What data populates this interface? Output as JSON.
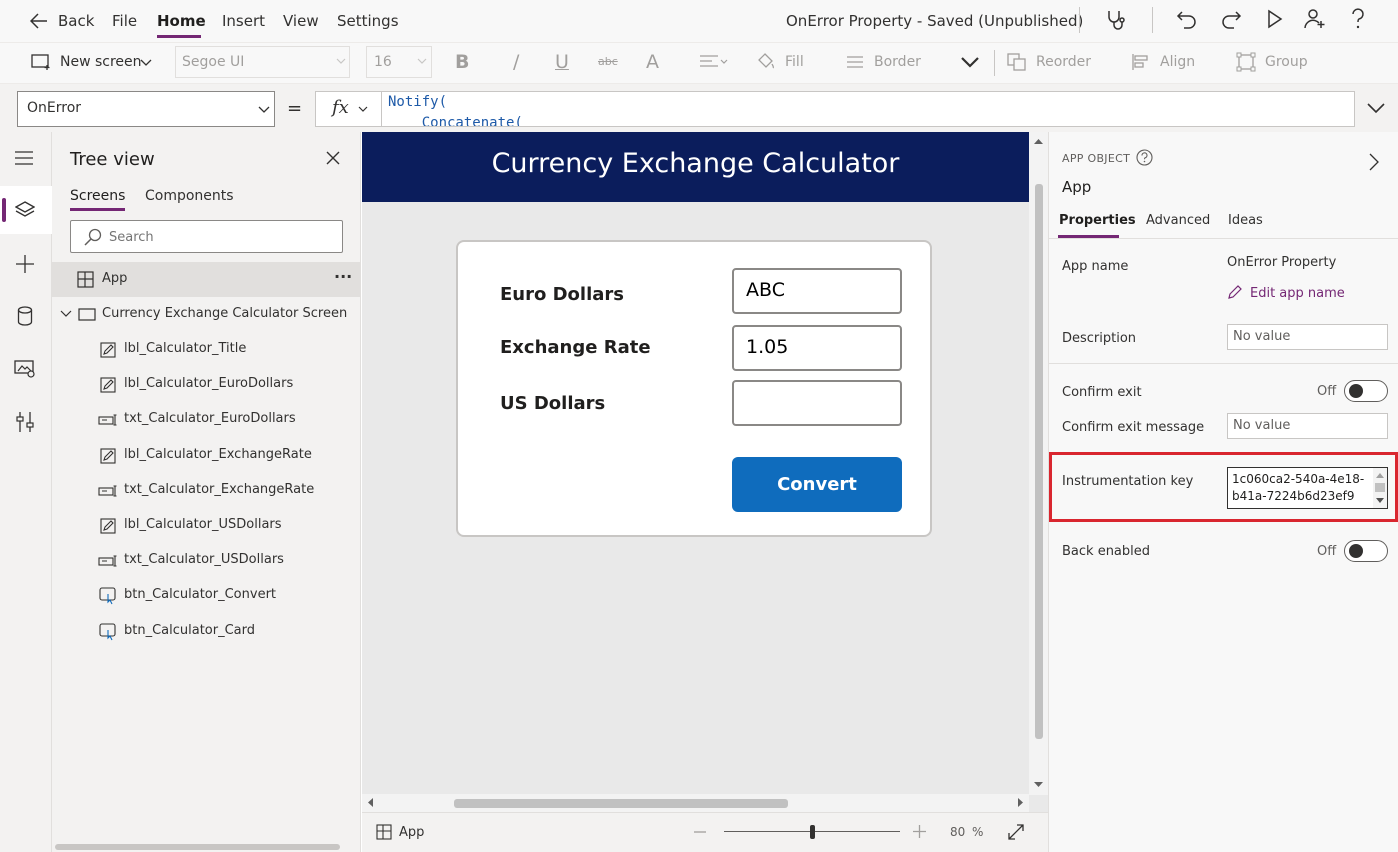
{
  "menubar": {
    "back_label": "Back",
    "file_label": "File",
    "home_label": "Home",
    "insert_label": "Insert",
    "view_label": "View",
    "settings_label": "Settings",
    "app_title": "OnError Property - Saved (Unpublished)"
  },
  "ribbon": {
    "new_screen_label": "New screen",
    "font_family": "Segoe UI",
    "font_size": "16",
    "bold_label": "B",
    "italic_label": "/",
    "underline_label": "U",
    "strike_label": "abc",
    "font_color_label": "A",
    "fill_label": "Fill",
    "border_label": "Border",
    "reorder_label": "Reorder",
    "align_label": "Align",
    "group_label": "Group"
  },
  "formula": {
    "property": "OnError",
    "equals": "=",
    "fx": "fx",
    "line1": "Notify(",
    "line2": "    Concatenate("
  },
  "tree": {
    "title": "Tree view",
    "tab_screens": "Screens",
    "tab_components": "Components",
    "search_placeholder": "Search",
    "app_label": "App",
    "more": "···",
    "screen_label": "Currency Exchange Calculator Screen",
    "items": [
      {
        "label": "lbl_Calculator_Title"
      },
      {
        "label": "lbl_Calculator_EuroDollars"
      },
      {
        "label": "txt_Calculator_EuroDollars"
      },
      {
        "label": "lbl_Calculator_ExchangeRate"
      },
      {
        "label": "txt_Calculator_ExchangeRate"
      },
      {
        "label": "lbl_Calculator_USDollars"
      },
      {
        "label": "txt_Calculator_USDollars"
      },
      {
        "label": "btn_Calculator_Convert"
      },
      {
        "label": "btn_Calculator_Card"
      }
    ]
  },
  "canvas": {
    "screen_title": "Currency Exchange Calculator",
    "euro_label": "Euro Dollars",
    "euro_value": "ABC",
    "rate_label": "Exchange Rate",
    "rate_value": "1.05",
    "usd_label": "US Dollars",
    "usd_value": "",
    "convert_label": "Convert"
  },
  "statusbar": {
    "app_label": "App",
    "zoom_value": "80",
    "zoom_unit": "%",
    "zoom_level": 0.8
  },
  "props": {
    "object_type": "APP OBJECT",
    "object_name": "App",
    "tab_properties": "Properties",
    "tab_advanced": "Advanced",
    "tab_ideas": "Ideas",
    "app_name_label": "App name",
    "app_name_value": "OnError Property",
    "edit_app_name": "Edit app name",
    "description_label": "Description",
    "description_value": "No value",
    "confirm_exit_label": "Confirm exit",
    "confirm_exit_state": "Off",
    "confirm_exit_message_label": "Confirm exit message",
    "confirm_exit_message_value": "No value",
    "instrumentation_key_label": "Instrumentation key",
    "instrumentation_key_line1": "1c060ca2-540a-4e18-",
    "instrumentation_key_line2": "b41a-7224b6d23ef9",
    "back_enabled_label": "Back enabled",
    "back_enabled_state": "Off"
  },
  "colors": {
    "accent": "#742774",
    "header_bg": "#0b1d5c",
    "button_bg": "#0f6cbd",
    "highlight_border": "#d9262f"
  }
}
